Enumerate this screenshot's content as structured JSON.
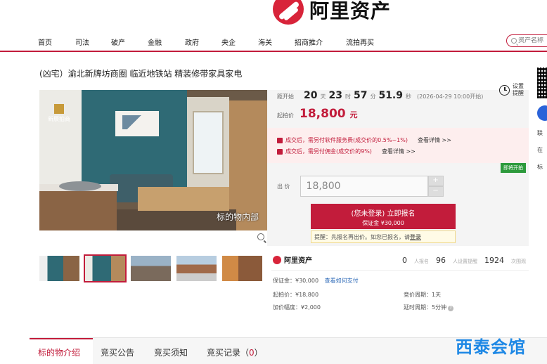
{
  "header": {
    "logo_text": "阿里资产",
    "nav": [
      "首页",
      "司法",
      "破产",
      "金融",
      "政府",
      "央企",
      "海关",
      "招商推介",
      "流拍再买"
    ],
    "search_placeholder": "资产名称"
  },
  "title": "(凶宅）渝北新牌坊商圈 临近地铁站 精装修带家具家电",
  "image": {
    "brand_label": "新辰拍商",
    "caption": "标的物内部"
  },
  "auction": {
    "countdown_label": "距开始",
    "days": "20",
    "days_unit": "天",
    "hours": "23",
    "hours_unit": "时",
    "minutes": "57",
    "minutes_unit": "分",
    "seconds": "51.9",
    "seconds_unit": "秒",
    "start_time": "(2026-04-29 10:00开始)",
    "reminder_label": "设置提醒",
    "start_price_label": "起拍价",
    "start_price": "18,800",
    "start_price_unit": "元",
    "fee1": "成交后，需另付软件服务费(成交价的0.5%~1%)",
    "fee2": "成交后，需另付佣金(成交价的9%)",
    "fee_link": "查看详情 >>",
    "buy_badge": "即将开拍",
    "bid_label": "出 价",
    "bid_value": "18,800",
    "stepper_plus": "+",
    "stepper_minus": "−",
    "signup_main": "(您未登录) 立即报名",
    "signup_sub": "保证金 ¥30,000",
    "hint_text": "提醒：先报名再出价。如您已报名，请",
    "hint_link": "登录"
  },
  "stats": {
    "brand": "阿里资产",
    "signups": "0",
    "signups_label": "人报名",
    "reminders": "96",
    "reminders_label": "人设置提醒",
    "views": "1924",
    "views_label": "次围观",
    "deposit": "保证金：¥30,000",
    "deposit_link": "查看如何支付",
    "start_price": "起拍价：¥18,800",
    "increment": "加价幅度：¥2,000",
    "cycle": "竞价周期：1天",
    "delay": "延时周期：5分钟"
  },
  "sidebar": {
    "item1": "联",
    "item2": "在",
    "item3": "标"
  },
  "tabs": [
    "标的物介绍",
    "竞买公告",
    "竞买须知",
    "竞买记录（",
    "0",
    "）"
  ],
  "watermark": "西泰会馆",
  "colors": {
    "brand_red": "#c21c3b",
    "green": "#2d9a3c",
    "link_blue": "#2f6bb8"
  }
}
